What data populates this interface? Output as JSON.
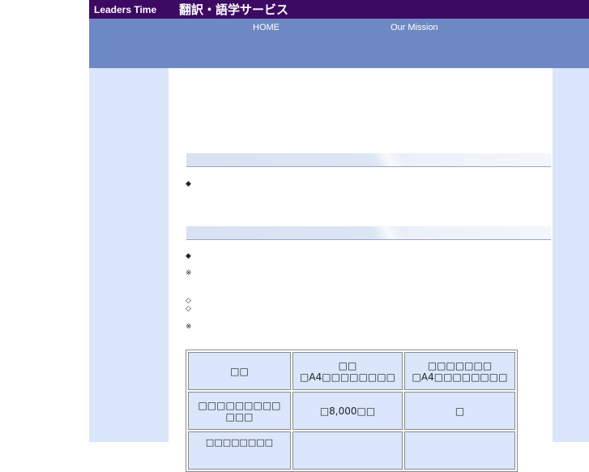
{
  "header": {
    "brand": "Leaders Time",
    "service_title": "翻訳・語学サービス"
  },
  "nav": {
    "home": "HOME",
    "mission": "Our Mission"
  },
  "section1": {
    "bullet": "◆"
  },
  "section2": {
    "bullet": "◆",
    "note1": "※",
    "diamond1": "◇",
    "diamond2": "◇",
    "note2": "※"
  },
  "pricing_table": {
    "header": {
      "col1": "□□",
      "col2_line1": "□□",
      "col2_line2": "□A4□□□□□□□□",
      "col3_line1": "□□□□□□□",
      "col3_line2": "□A4□□□□□□□□"
    },
    "row1": {
      "label_line1": "□□□□□□□□□",
      "label_line2": "□□□",
      "price": "□8,000□□",
      "extra": "□"
    },
    "row2": {
      "label_line1": "□□□□□□□□",
      "price": "",
      "extra": ""
    }
  },
  "colors": {
    "topbar": "#3d0a63",
    "navband": "#6e88c4",
    "sidebar": "#d9e6fb",
    "cell": "#d9e6fb"
  }
}
